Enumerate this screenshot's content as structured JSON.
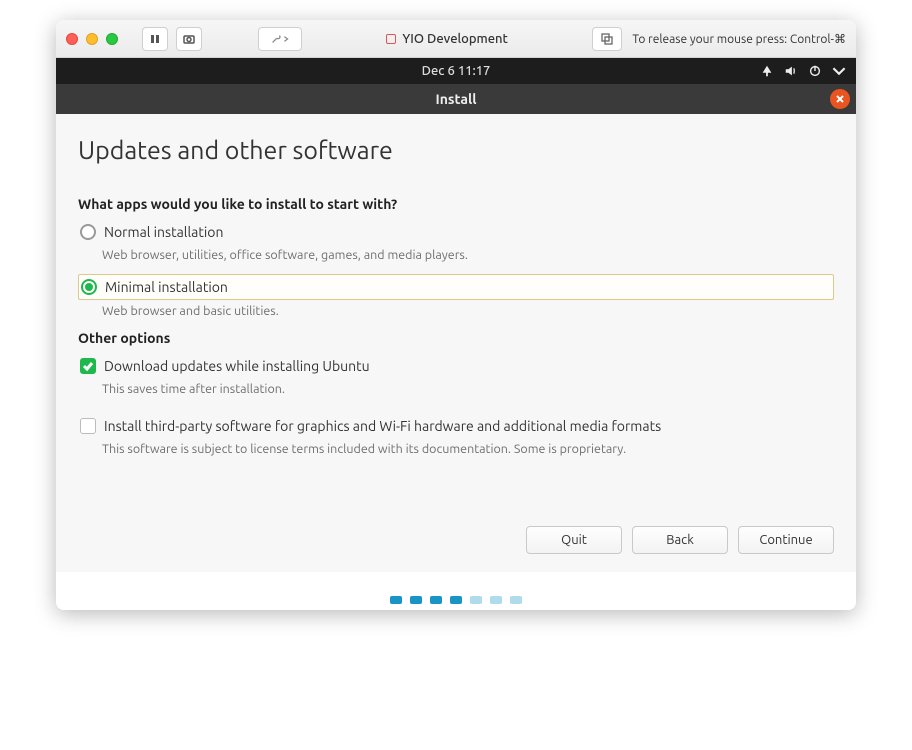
{
  "host": {
    "title": "YIO Development",
    "mouse_hint": "To release your mouse press: Control-⌘"
  },
  "ubuntu": {
    "clock": "Dec 6  11:17"
  },
  "installer": {
    "titlebar": "Install",
    "heading": "Updates and other software",
    "question": "What apps would you like to install to start with?",
    "normal": {
      "label": "Normal installation",
      "desc": "Web browser, utilities, office software, games, and media players."
    },
    "minimal": {
      "label": "Minimal installation",
      "desc": "Web browser and basic utilities."
    },
    "other_options": "Other options",
    "download": {
      "label": "Download updates while installing Ubuntu",
      "desc": "This saves time after installation."
    },
    "thirdparty": {
      "label": "Install third-party software for graphics and Wi-Fi hardware and additional media formats",
      "desc": "This software is subject to license terms included with its documentation. Some is proprietary."
    },
    "buttons": {
      "quit": "Quit",
      "back": "Back",
      "continue": "Continue"
    }
  }
}
